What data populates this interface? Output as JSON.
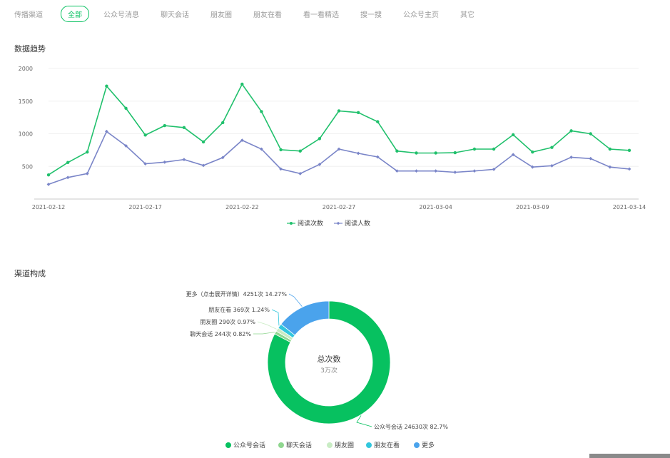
{
  "tabs": {
    "label": "传播渠道",
    "items": [
      "全部",
      "公众号消息",
      "聊天会话",
      "朋友圈",
      "朋友在看",
      "看一看精选",
      "搜一搜",
      "公众号主页",
      "其它"
    ],
    "active_index": 0
  },
  "trend_title": "数据趋势",
  "channel_title": "渠道构成",
  "colors": {
    "accent": "#07c160",
    "series_reads": "#20c06c",
    "series_readers": "#7a85c8"
  },
  "chart_data": [
    {
      "type": "line",
      "x": [
        "2021-02-12",
        "2021-02-13",
        "2021-02-14",
        "2021-02-15",
        "2021-02-16",
        "2021-02-17",
        "2021-02-18",
        "2021-02-19",
        "2021-02-20",
        "2021-02-21",
        "2021-02-22",
        "2021-02-23",
        "2021-02-24",
        "2021-02-25",
        "2021-02-26",
        "2021-02-27",
        "2021-02-28",
        "2021-03-01",
        "2021-03-02",
        "2021-03-03",
        "2021-03-04",
        "2021-03-05",
        "2021-03-06",
        "2021-03-07",
        "2021-03-08",
        "2021-03-09",
        "2021-03-10",
        "2021-03-11",
        "2021-03-12",
        "2021-03-13",
        "2021-03-14"
      ],
      "x_ticks": [
        "2021-02-12",
        "2021-02-17",
        "2021-02-22",
        "2021-02-27",
        "2021-03-04",
        "2021-03-09",
        "2021-03-14"
      ],
      "series": [
        {
          "name": "阅读次数",
          "values": [
            370,
            560,
            720,
            1730,
            1390,
            980,
            1125,
            1095,
            875,
            1170,
            1760,
            1340,
            755,
            735,
            925,
            1350,
            1325,
            1185,
            735,
            705,
            705,
            710,
            765,
            765,
            985,
            720,
            790,
            1045,
            1000,
            765,
            745
          ]
        },
        {
          "name": "阅读人数",
          "values": [
            225,
            330,
            390,
            1035,
            815,
            540,
            565,
            605,
            515,
            635,
            900,
            765,
            460,
            390,
            530,
            765,
            700,
            645,
            430,
            430,
            430,
            410,
            430,
            455,
            680,
            490,
            510,
            640,
            620,
            490,
            460
          ]
        }
      ],
      "y_ticks": [
        500,
        1000,
        1500,
        2000
      ],
      "ylim": [
        0,
        2000
      ],
      "grid": true,
      "legend_position": "bottom-center"
    },
    {
      "type": "pie",
      "center_label": "总次数",
      "center_value": "3万次",
      "slices": [
        {
          "name": "公众号会话",
          "value": 24630,
          "percent": 82.7,
          "label": "公众号会话 24630次 82.7%",
          "color": "#07c160"
        },
        {
          "name": "聊天会话",
          "value": 244,
          "percent": 0.82,
          "label": "聊天会话 244次 0.82%",
          "color": "#8fd68f"
        },
        {
          "name": "朋友圈",
          "value": 290,
          "percent": 0.97,
          "label": "朋友圈 290次 0.97%",
          "color": "#c9ecc4"
        },
        {
          "name": "朋友在看",
          "value": 369,
          "percent": 1.24,
          "label": "朋友在看 369次 1.24%",
          "color": "#32c7dd"
        },
        {
          "name": "更多",
          "value": 4251,
          "percent": 14.27,
          "label": "更多（点击展开详情）4251次 14.27%",
          "color": "#4aa3ec"
        }
      ],
      "legend": [
        "公众号会话",
        "聊天会话",
        "朋友圈",
        "朋友在看",
        "更多"
      ],
      "legend_position": "bottom-center"
    }
  ]
}
